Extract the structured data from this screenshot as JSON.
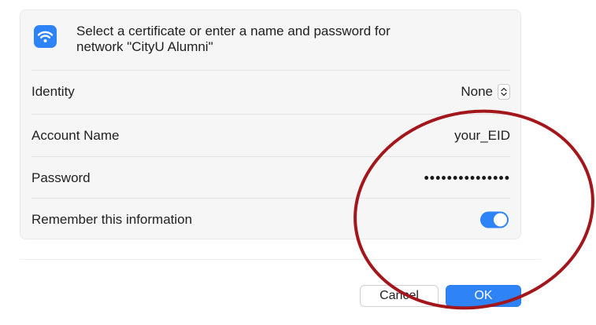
{
  "dialog": {
    "icon": "wifi-icon",
    "message_line1": "Select a certificate or enter a name and password for",
    "message_line2": "network \"CityU Alumni\""
  },
  "form": {
    "identity": {
      "label": "Identity",
      "value": "None",
      "control_icon": "up-down-chevron-icon"
    },
    "account_name": {
      "label": "Account Name",
      "value": "your_EID"
    },
    "password": {
      "label": "Password",
      "value": "•••••••••••••••"
    },
    "remember": {
      "label": "Remember this information",
      "enabled": true
    }
  },
  "buttons": {
    "cancel": "Cancel",
    "ok": "OK"
  },
  "colors": {
    "accent": "#2e83f6",
    "annotation": "#a3161b"
  }
}
